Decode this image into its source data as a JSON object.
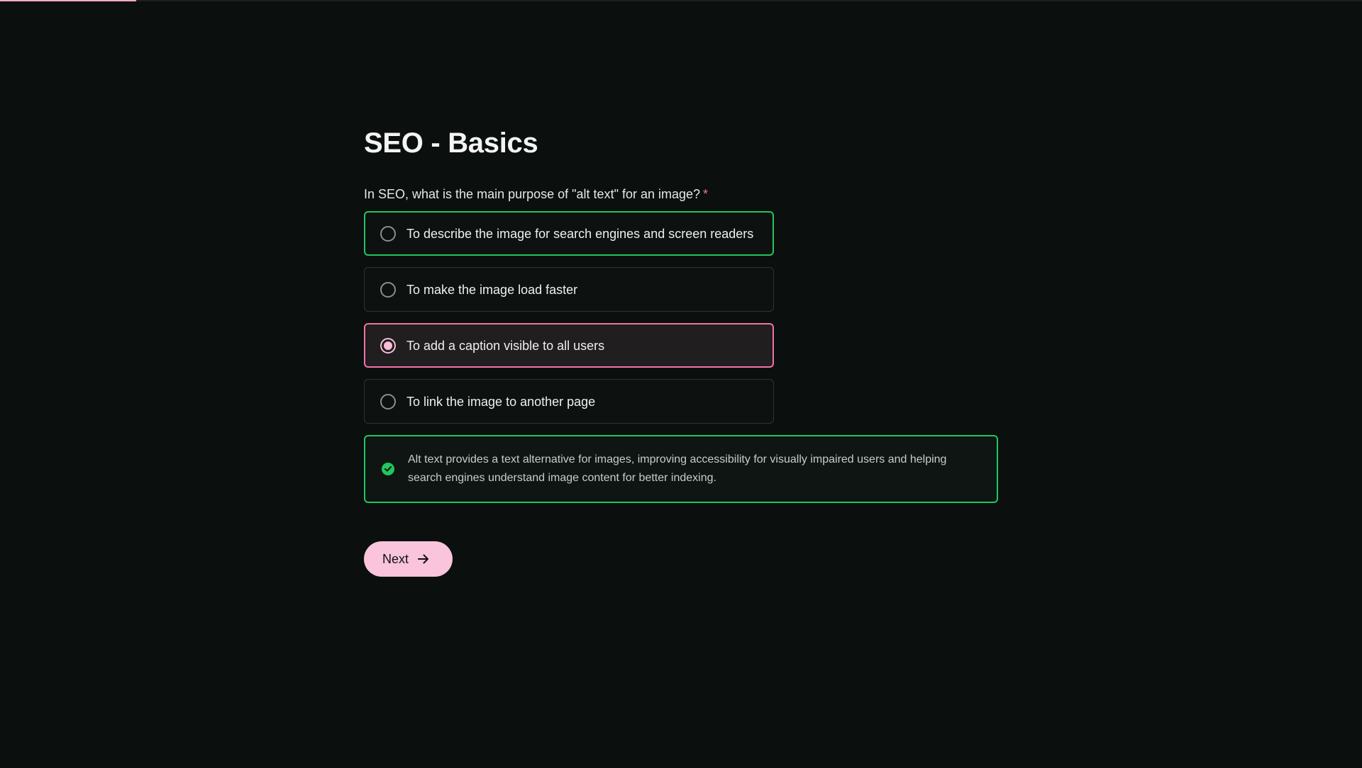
{
  "progress": {
    "fraction": 0.1
  },
  "quiz": {
    "title": "SEO - Basics",
    "question": "In SEO, what is the main purpose of \"alt text\" for an image?",
    "required_marker": "*",
    "options": [
      {
        "label": "To describe the image for search engines and screen readers",
        "state": "correct"
      },
      {
        "label": "To make the image load faster",
        "state": "default"
      },
      {
        "label": "To add a caption visible to all users",
        "state": "selected-wrong"
      },
      {
        "label": "To link the image to another page",
        "state": "default"
      }
    ],
    "feedback": {
      "icon": "check-circle-icon",
      "text": "Alt text provides a text alternative for images, improving accessibility for visually impaired users and helping search engines understand image content for better indexing."
    },
    "next_label": "Next"
  },
  "colors": {
    "background": "#0b0f0e",
    "correct": "#22c55e",
    "selected": "#f472a8",
    "accent": "#f9c4dc"
  }
}
